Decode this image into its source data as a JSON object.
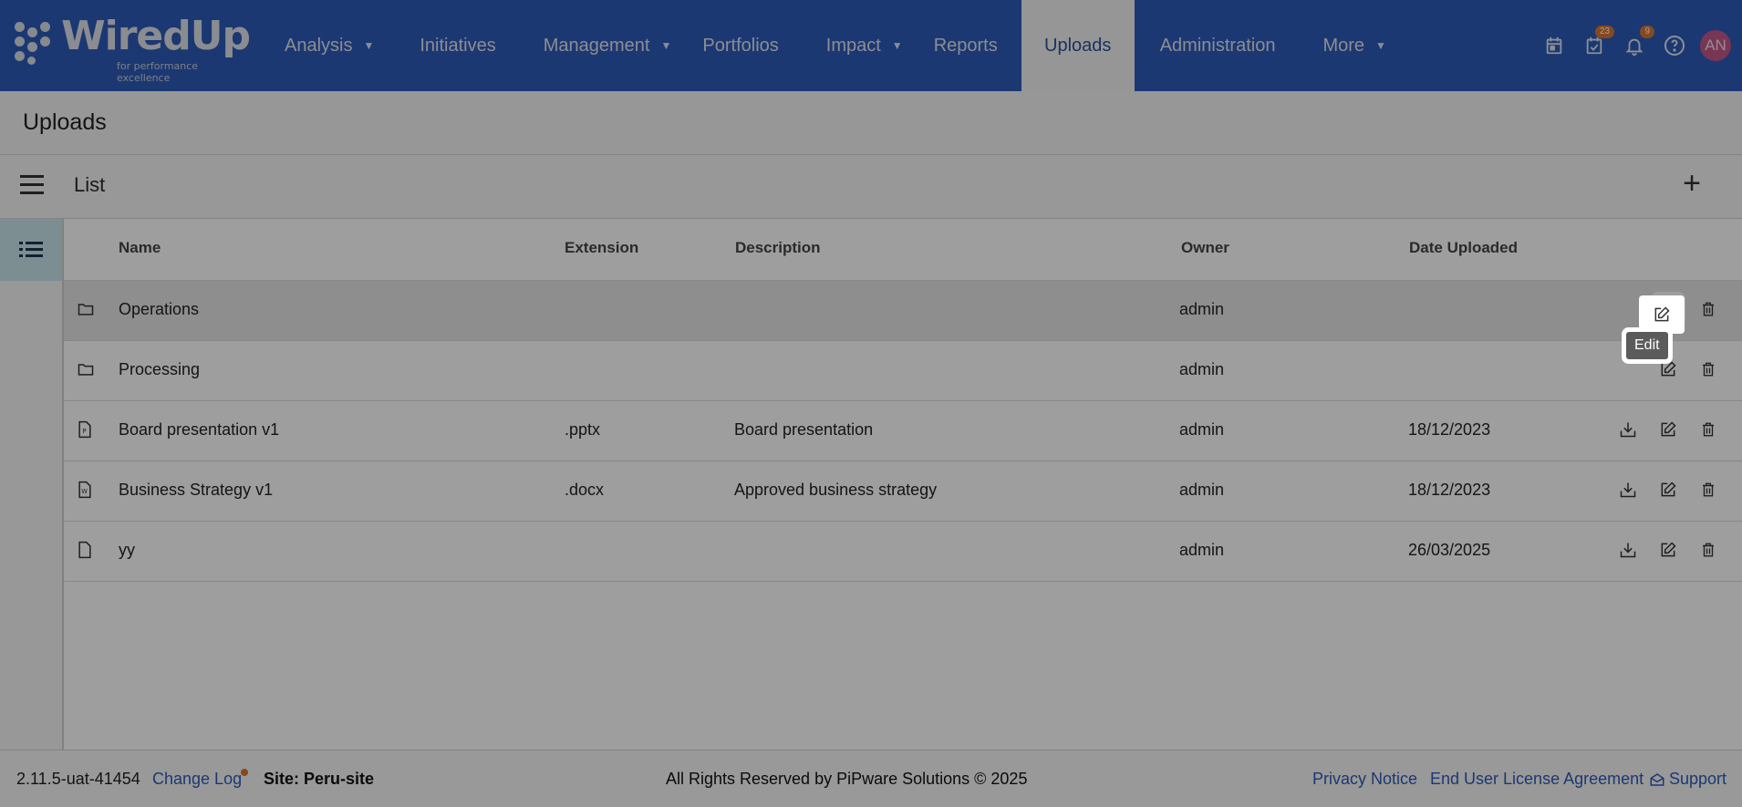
{
  "app": {
    "logo_text": "WiredUp",
    "logo_tagline": "for performance excellence"
  },
  "nav": {
    "items": [
      {
        "label": "Analysis",
        "dropdown": true
      },
      {
        "label": "Initiatives",
        "dropdown": false
      },
      {
        "label": "Management",
        "dropdown": true
      },
      {
        "label": "Portfolios",
        "dropdown": false
      },
      {
        "label": "Impact",
        "dropdown": true
      },
      {
        "label": "Reports",
        "dropdown": false
      },
      {
        "label": "Uploads",
        "dropdown": false,
        "active": true
      },
      {
        "label": "Administration",
        "dropdown": false
      },
      {
        "label": "More",
        "dropdown": true
      }
    ],
    "icons": {
      "calendar": "calendar-icon",
      "tasks": "task-check-icon",
      "tasks_badge": "23",
      "notifications": "bell-icon",
      "notifications_badge": "9",
      "help": "help-icon"
    },
    "avatar_initials": "AN"
  },
  "page": {
    "title": "Uploads"
  },
  "list": {
    "title": "List",
    "add_label": "+"
  },
  "table": {
    "headers": {
      "name": "Name",
      "extension": "Extension",
      "description": "Description",
      "owner": "Owner",
      "date": "Date Uploaded"
    },
    "rows": [
      {
        "icon": "folder-icon",
        "name": "Operations",
        "extension": "",
        "description": "",
        "owner": "admin",
        "date": "",
        "download": false
      },
      {
        "icon": "folder-icon",
        "name": "Processing",
        "extension": "",
        "description": "",
        "owner": "admin",
        "date": "",
        "download": false
      },
      {
        "icon": "powerpoint-file-icon",
        "name": "Board presentation v1",
        "extension": ".pptx",
        "description": "Board presentation",
        "owner": "admin",
        "date": "18/12/2023",
        "download": true
      },
      {
        "icon": "word-file-icon",
        "name": "Business Strategy v1",
        "extension": ".docx",
        "description": "Approved business strategy",
        "owner": "admin",
        "date": "18/12/2023",
        "download": true
      },
      {
        "icon": "file-icon",
        "name": "yy",
        "extension": "",
        "description": "",
        "owner": "admin",
        "date": "26/03/2025",
        "download": true
      }
    ]
  },
  "tooltip": {
    "text": "Edit"
  },
  "footer": {
    "version": "2.11.5-uat-41454",
    "change_log": "Change Log",
    "site": "Site: Peru-site",
    "rights": "All Rights Reserved by PiPware Solutions © 2025",
    "privacy": "Privacy Notice",
    "eula": "End User License Agreement",
    "support": "Support"
  },
  "colors": {
    "nav_bg": "#2d5bb9",
    "accent_orange": "#d9762f",
    "avatar_bg": "#c2588a",
    "link": "#2d5bb9"
  }
}
